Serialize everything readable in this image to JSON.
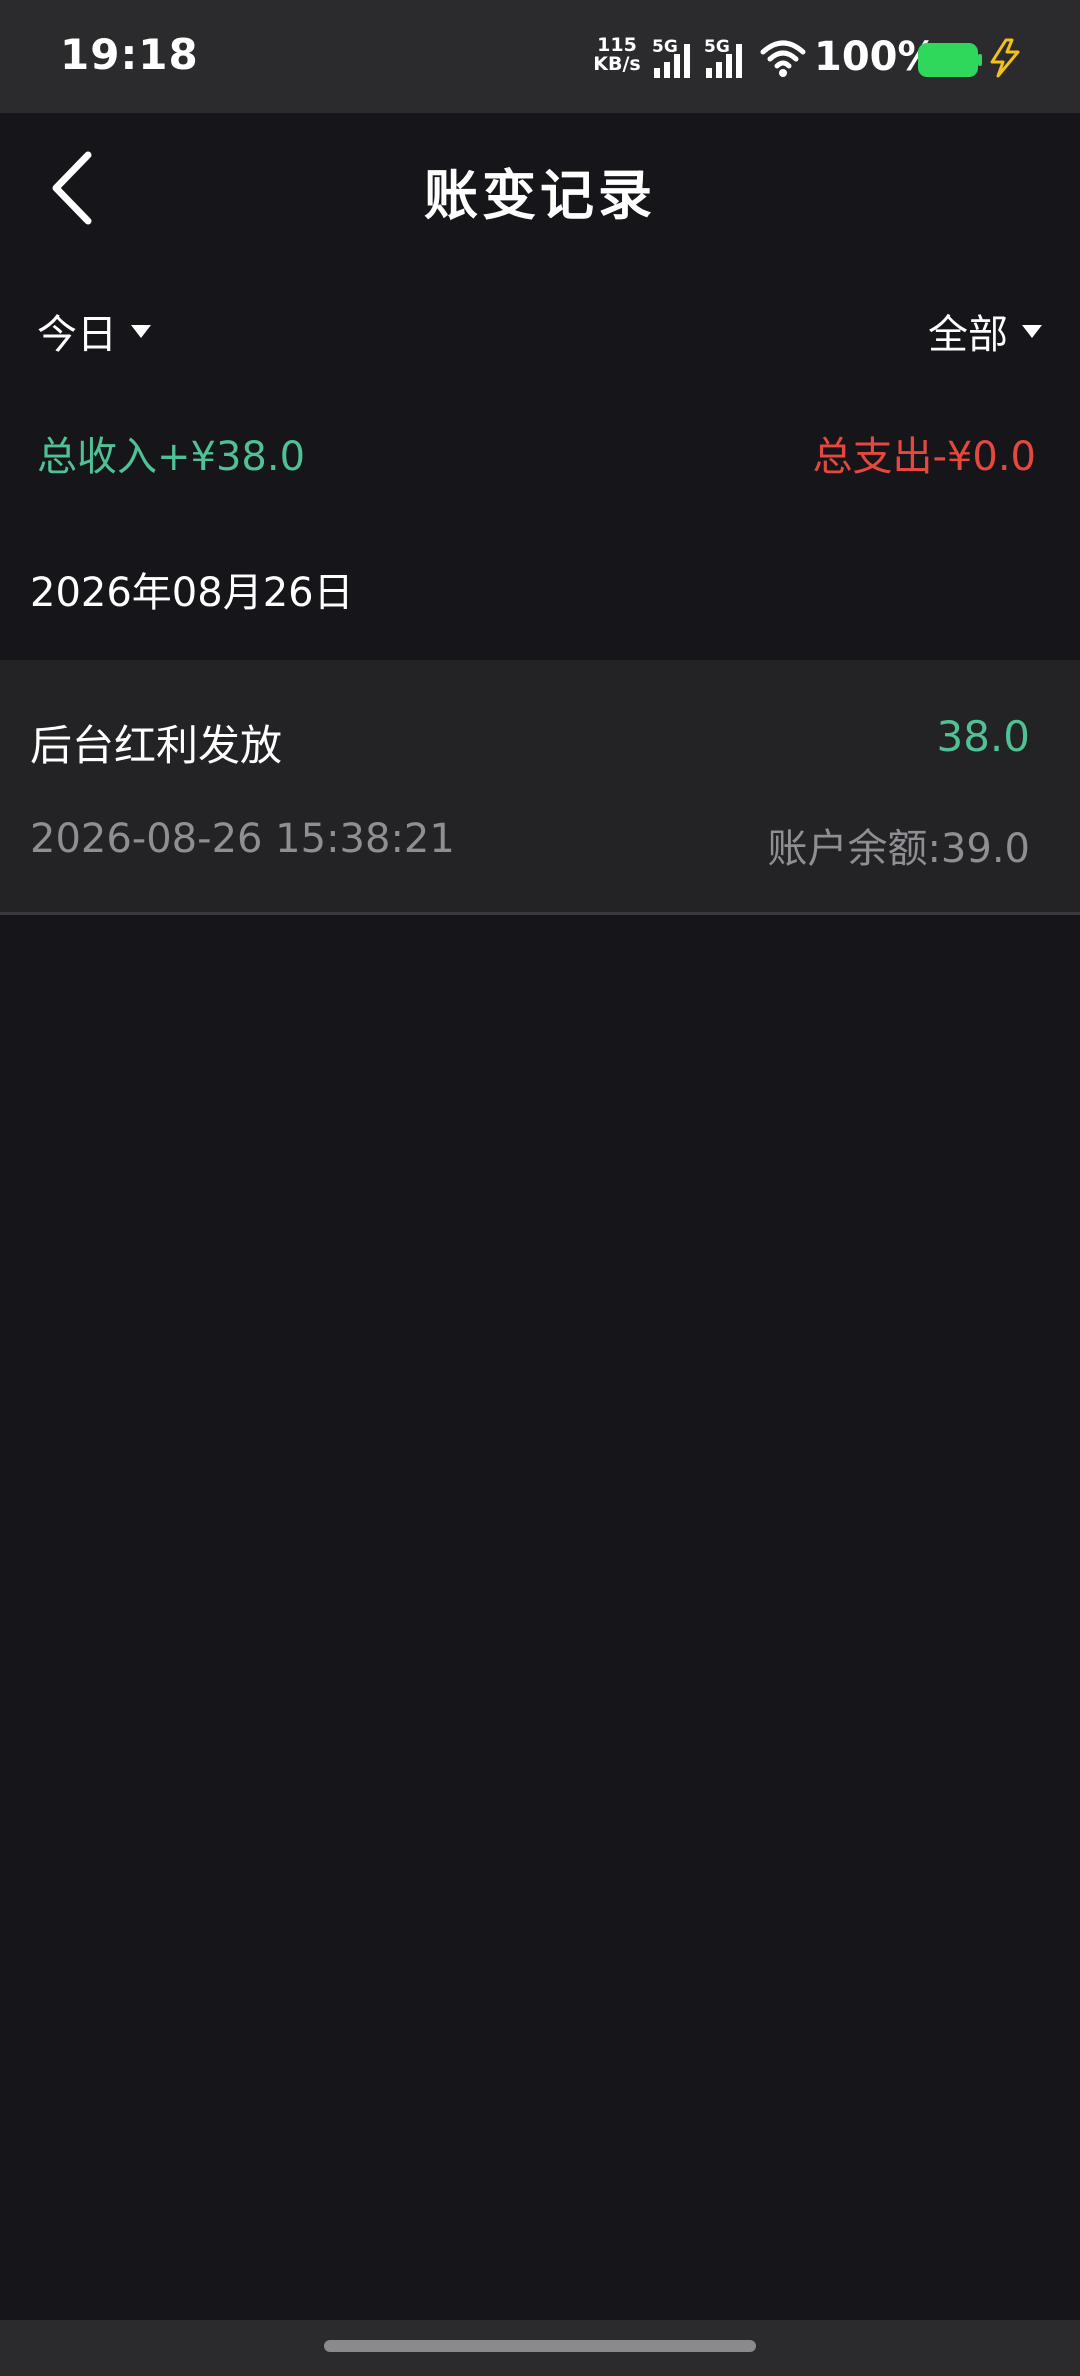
{
  "status_bar": {
    "time": "19:18",
    "net_speed_value": "115",
    "net_speed_unit": "KB/s",
    "sim1_label": "5G",
    "sim2_label": "5G",
    "battery_percent": "100%",
    "battery_color": "#2fd75a",
    "charge_color": "#f2c21b",
    "icons": [
      "signal-icon",
      "signal-icon",
      "wifi-icon",
      "battery-icon",
      "charging-icon"
    ]
  },
  "header": {
    "title": "账变记录",
    "back_icon": "chevron-left-icon"
  },
  "filters": {
    "period": "今日",
    "type": "全部"
  },
  "summary": {
    "income": "总收入+¥38.0",
    "expense": "总支出-¥0.0",
    "income_color": "#4fc194",
    "expense_color": "#e4483e"
  },
  "groups": [
    {
      "date": "2026年08月26日",
      "records": [
        {
          "title": "后台红利发放",
          "amount": "38.0",
          "time": "2026-08-26 15:38:21",
          "balance": "账户余额:39.0"
        }
      ]
    }
  ]
}
